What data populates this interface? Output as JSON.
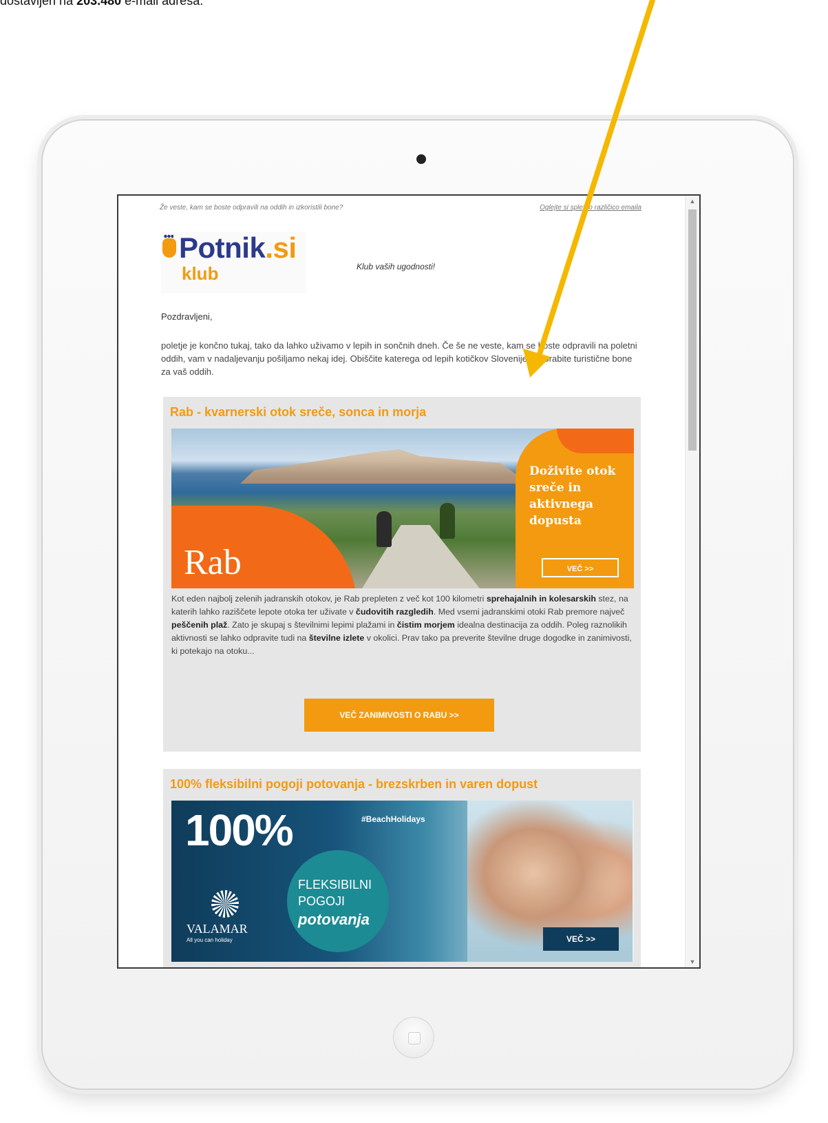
{
  "caption": {
    "prefix": "dostavljen na ",
    "count": "203.480",
    "suffix": " e-mail adresa."
  },
  "email": {
    "preheader_left": "Že veste, kam se boste odpravili na oddih in izkoristili bone?",
    "preheader_right": "Oglejte si spletno različico emaila",
    "logo_brand": "Potnik",
    "logo_tld": ".si",
    "logo_klub": "klub",
    "tagline": "Klub vaših ugodnosti!",
    "greeting": "Pozdravljeni,",
    "intro": "poletje je končno tukaj, tako da lahko uživamo v lepih in sončnih dneh. Če še ne veste, kam se boste odpravili na poletni oddih, vam v nadaljevanju pošiljamo nekaj idej. Obiščite katerega od lepih kotičkov Slovenije in porabite turistične bone za vaš oddih.",
    "sections": [
      {
        "title": "Rab - kvarnerski otok sreče, sonca in morja",
        "banner_name": "Rab",
        "banner_slogan": "Doživite otok sreče in aktivnega dopusta",
        "banner_button": "VEČ >>",
        "text_parts": [
          "Kot eden najbolj zelenih jadranskih otokov, je Rab prepleten z več kot 100 kilometri ",
          "sprehajalnih in kolesarskih",
          " stez, na katerih lahko raziščete lepote otoka ter uživate v ",
          "čudovitih razgledih",
          ". Med vsemi jadranskimi otoki Rab premore največ ",
          "peščenih plaž",
          ". Zato je skupaj s številnimi lepimi plažami in ",
          "čistim morjem",
          " idealna destinacija za oddih. Poleg raznolikih aktivnosti se lahko odpravite tudi na ",
          "številne izlete",
          " v okolici. Prav tako pa preverite številne druge dogodke in zanimivosti, ki potekajo na otoku..."
        ],
        "cta": "VEČ ZANIMIVOSTI O RABU >>"
      },
      {
        "title": "100% fleksibilni pogoji potovanja - brezskrben in varen dopust",
        "banner_big": "100%",
        "banner_hashtag": "#BeachHolidays",
        "banner_line1": "FLEKSIBILNI",
        "banner_line2": "POGOJI",
        "banner_line3": "potovanja",
        "banner_brand": "VALAMAR",
        "banner_brand_sub": "All you can holiday",
        "banner_button": "VEČ >>"
      }
    ]
  },
  "colors": {
    "accent": "#f39a10",
    "arrow": "#f5b800",
    "brand_blue": "#2c3a8c"
  }
}
